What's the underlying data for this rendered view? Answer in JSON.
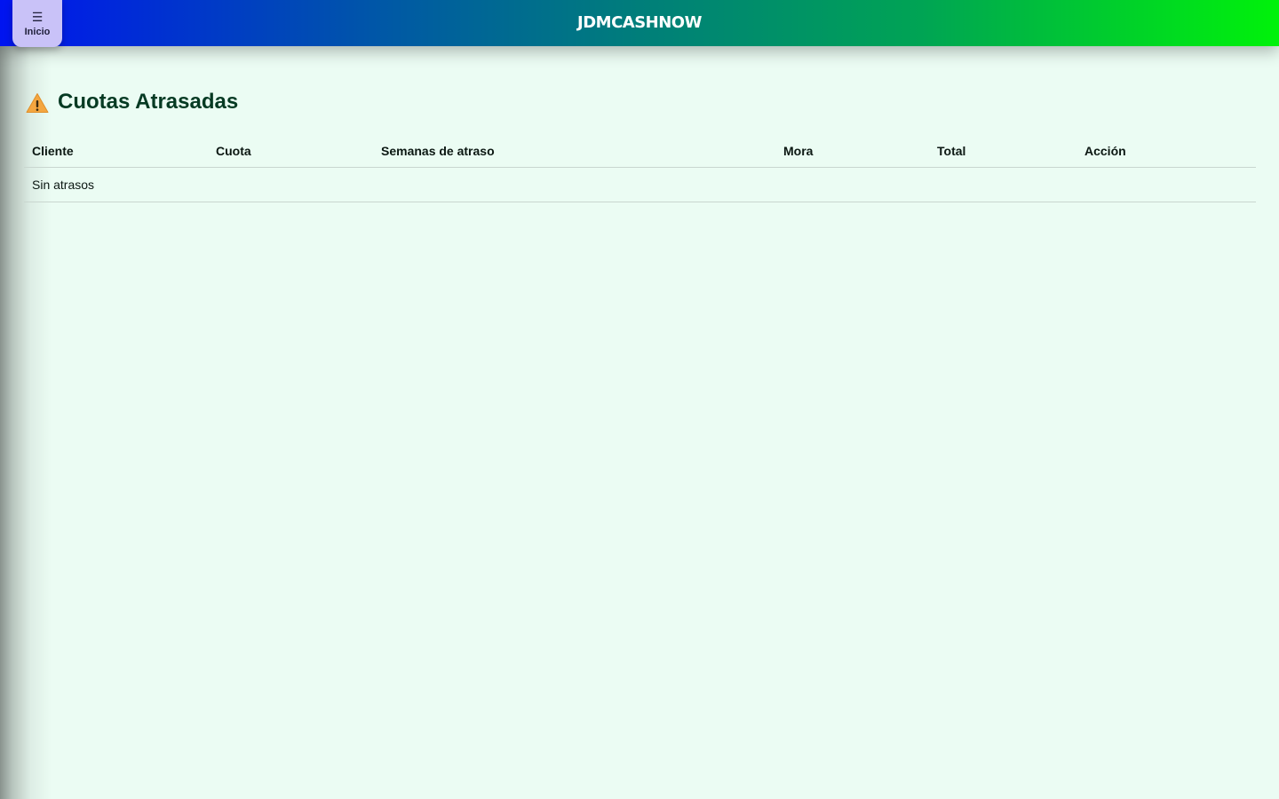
{
  "header": {
    "brand": "JDMCASHNOW",
    "menu_button_label": "Inicio",
    "menu_icon": "hamburger-icon"
  },
  "main": {
    "title": "Cuotas Atrasadas",
    "title_icon": "warning-icon",
    "table": {
      "columns": [
        "Cliente",
        "Cuota",
        "Semanas de atraso",
        "Mora",
        "Total",
        "Acción"
      ],
      "empty_message": "Sin atrasos"
    }
  },
  "colors": {
    "header_gradient_start": "#0014f0",
    "header_gradient_end": "#00f20a",
    "page_background": "#ebfcf3",
    "menu_button_bg": "#c9c2f8",
    "title_color": "#063a23",
    "warning_icon": "#f4a640"
  }
}
